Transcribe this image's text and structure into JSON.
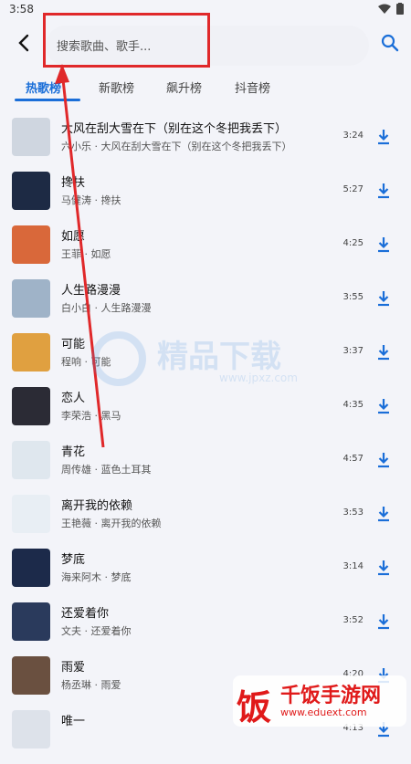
{
  "status": {
    "time": "3:58"
  },
  "search": {
    "placeholder": "搜索歌曲、歌手..."
  },
  "tabs": [
    {
      "label": "热歌榜",
      "active": true
    },
    {
      "label": "新歌榜",
      "active": false
    },
    {
      "label": "飙升榜",
      "active": false
    },
    {
      "label": "抖音榜",
      "active": false
    }
  ],
  "songs": [
    {
      "title": "大风在刮大雪在下（别在这个冬把我丢下）",
      "subtitle": "六小乐 · 大风在刮大雪在下（别在这个冬把我丢下）",
      "duration": "3:24"
    },
    {
      "title": "搀扶",
      "subtitle": "马健涛 · 搀扶",
      "duration": "5:27"
    },
    {
      "title": "如愿",
      "subtitle": "王菲 · 如愿",
      "duration": "4:25"
    },
    {
      "title": "人生路漫漫",
      "subtitle": "白小白 · 人生路漫漫",
      "duration": "3:55"
    },
    {
      "title": "可能",
      "subtitle": "程响 · 可能",
      "duration": "3:37"
    },
    {
      "title": "恋人",
      "subtitle": "李荣浩 · 黑马",
      "duration": "4:35"
    },
    {
      "title": "青花",
      "subtitle": "周传雄 · 蓝色土耳其",
      "duration": "4:57"
    },
    {
      "title": "离开我的依赖",
      "subtitle": "王艳薇 · 离开我的依赖",
      "duration": "3:53"
    },
    {
      "title": "梦底",
      "subtitle": "海来阿木 · 梦底",
      "duration": "3:14"
    },
    {
      "title": "还爱着你",
      "subtitle": "文夫 · 还爱着你",
      "duration": "3:52"
    },
    {
      "title": "雨爱",
      "subtitle": "杨丞琳 · 雨爱",
      "duration": "4:20"
    },
    {
      "title": "唯一",
      "subtitle": "",
      "duration": "4:13"
    }
  ],
  "watermark": {
    "text": "精品下载",
    "url": "www.jpxz.com"
  },
  "logo": {
    "name": "千饭手游网",
    "url": "www.eduext.com"
  },
  "colors": {
    "accent": "#1a6ed8",
    "annotation": "#e0282a"
  }
}
